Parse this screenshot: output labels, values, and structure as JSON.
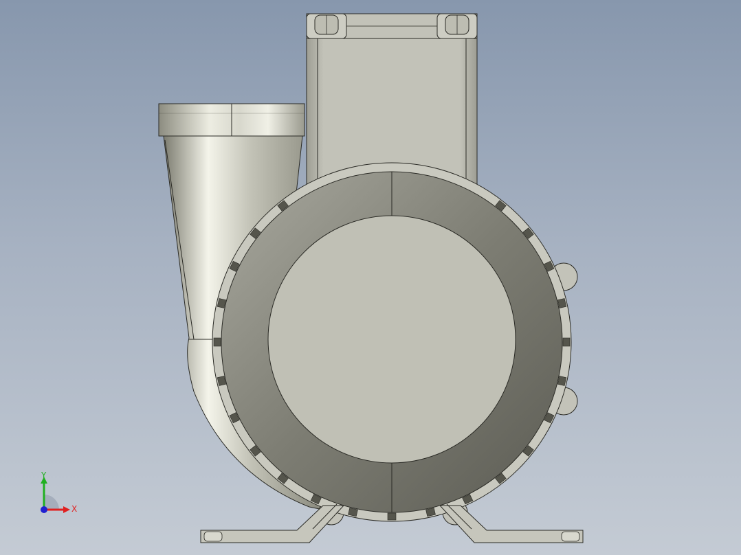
{
  "viewport": {
    "background_top": "#8797ad",
    "background_bottom": "#c4cbd4"
  },
  "model": {
    "subject": "centrifugal-blower",
    "colors": {
      "body": "#bfbfb4",
      "shade": "#6a6a60",
      "edge": "#2a2a25",
      "slot": "#55554c"
    },
    "bolt_slot_count": 28
  },
  "triad": {
    "x_label": "X",
    "y_label": "Y",
    "x_color": "#e02020",
    "y_color": "#20b020",
    "z_color": "#2020d0"
  }
}
